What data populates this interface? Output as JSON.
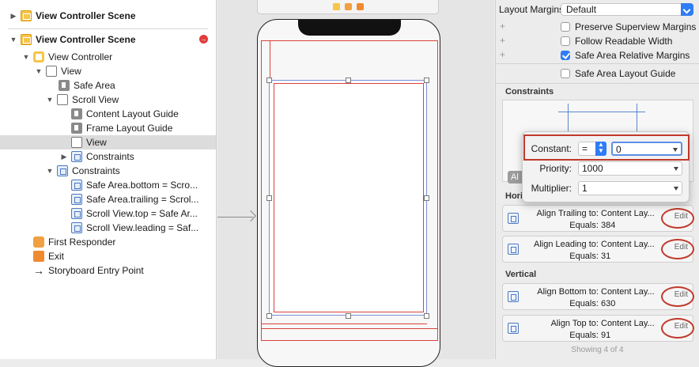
{
  "outline": {
    "items": [
      {
        "label": "View Controller Scene",
        "bold": true
      },
      {
        "label": "View Controller Scene",
        "bold": true
      },
      {
        "label": "View Controller"
      },
      {
        "label": "View"
      },
      {
        "label": "Safe Area"
      },
      {
        "label": "Scroll View"
      },
      {
        "label": "Content Layout Guide"
      },
      {
        "label": "Frame Layout Guide"
      },
      {
        "label": "View"
      },
      {
        "label": "Constraints"
      },
      {
        "label": "Constraints"
      },
      {
        "label": "Safe Area.bottom = Scro..."
      },
      {
        "label": "Safe Area.trailing = Scrol..."
      },
      {
        "label": "Scroll View.top = Safe Ar..."
      },
      {
        "label": "Scroll View.leading = Saf..."
      },
      {
        "label": "First Responder"
      },
      {
        "label": "Exit"
      },
      {
        "label": "Storyboard Entry Point"
      }
    ]
  },
  "inspector": {
    "layout_margins_label": "Layout Margins",
    "layout_margins_value": "Default",
    "checks": [
      {
        "label": "Preserve Superview Margins",
        "checked": false
      },
      {
        "label": "Follow Readable Width",
        "checked": false
      },
      {
        "label": "Safe Area Relative Margins",
        "checked": true
      },
      {
        "label": "Safe Area Layout Guide",
        "checked": false
      }
    ],
    "constraints_header": "Constraints",
    "horizontal_header": "Hori",
    "vertical_header": "Vertical",
    "all_chip": "Al",
    "cards": [
      {
        "line1_label": "Align Trailing to:",
        "line1_value": "Content Lay...",
        "line2_label": "Equals:",
        "line2_value": "384",
        "edit": "Edit"
      },
      {
        "line1_label": "Align Leading to:",
        "line1_value": "Content Lay...",
        "line2_label": "Equals:",
        "line2_value": "31",
        "edit": "Edit"
      },
      {
        "line1_label": "Align Bottom to:",
        "line1_value": "Content Lay...",
        "line2_label": "Equals:",
        "line2_value": "630",
        "edit": "Edit"
      },
      {
        "line1_label": "Align Top to:",
        "line1_value": "Content Lay...",
        "line2_label": "Equals:",
        "line2_value": "91",
        "edit": "Edit"
      }
    ],
    "showing": "Showing 4 of 4"
  },
  "popover": {
    "constant_label": "Constant:",
    "relation": "=",
    "constant_value": "0",
    "priority_label": "Priority:",
    "priority_value": "1000",
    "multiplier_label": "Multiplier:",
    "multiplier_value": "1"
  },
  "colors": {
    "accent": "#2e7cf6",
    "annotation_red": "#c0392b",
    "scene_icon": "#f6c54a"
  }
}
